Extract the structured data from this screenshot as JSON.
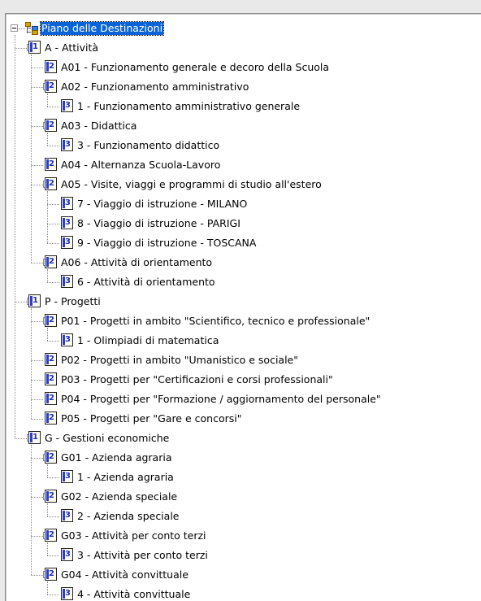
{
  "tree": {
    "root": {
      "label": "Piano delle Destinazioni",
      "selected": true
    },
    "nodes": [
      {
        "level": 1,
        "badge": "1",
        "label": "A - Attività",
        "expander": true
      },
      {
        "level": 2,
        "badge": "2",
        "label": "A01 - Funzionamento generale e decoro della Scuola",
        "expander": false
      },
      {
        "level": 2,
        "badge": "2",
        "label": "A02 - Funzionamento amministrativo",
        "expander": true
      },
      {
        "level": 3,
        "badge": "3",
        "label": "1 - Funzionamento amministrativo generale",
        "expander": false
      },
      {
        "level": 2,
        "badge": "2",
        "label": "A03 - Didattica",
        "expander": true
      },
      {
        "level": 3,
        "badge": "3",
        "label": "3 - Funzionamento didattico",
        "expander": false
      },
      {
        "level": 2,
        "badge": "2",
        "label": "A04 - Alternanza Scuola-Lavoro",
        "expander": false
      },
      {
        "level": 2,
        "badge": "2",
        "label": "A05 - Visite, viaggi e programmi di studio all'estero",
        "expander": true
      },
      {
        "level": 3,
        "badge": "3",
        "label": "7 - Viaggio di istruzione - MILANO",
        "expander": false
      },
      {
        "level": 3,
        "badge": "3",
        "label": "8 - Viaggio di istruzione - PARIGI",
        "expander": false
      },
      {
        "level": 3,
        "badge": "3",
        "label": "9 - Viaggio di istruzione - TOSCANA",
        "expander": false
      },
      {
        "level": 2,
        "badge": "2",
        "label": "A06 - Attività di orientamento",
        "expander": true
      },
      {
        "level": 3,
        "badge": "3",
        "label": "6 - Attività di orientamento",
        "expander": false
      },
      {
        "level": 1,
        "badge": "1",
        "label": "P - Progetti",
        "expander": true
      },
      {
        "level": 2,
        "badge": "2",
        "label": "P01 - Progetti in ambito \"Scientifico, tecnico e professionale\"",
        "expander": true
      },
      {
        "level": 3,
        "badge": "3",
        "label": "1 - Olimpiadi di matematica",
        "expander": false
      },
      {
        "level": 2,
        "badge": "2",
        "label": "P02 - Progetti in ambito \"Umanistico e sociale\"",
        "expander": false
      },
      {
        "level": 2,
        "badge": "2",
        "label": "P03 - Progetti per \"Certificazioni e corsi professionali\"",
        "expander": false
      },
      {
        "level": 2,
        "badge": "2",
        "label": "P04 - Progetti per \"Formazione / aggiornamento del personale\"",
        "expander": false
      },
      {
        "level": 2,
        "badge": "2",
        "label": "P05 - Progetti per \"Gare e concorsi\"",
        "expander": false
      },
      {
        "level": 1,
        "badge": "1",
        "label": "G - Gestioni economiche",
        "expander": true
      },
      {
        "level": 2,
        "badge": "2",
        "label": "G01 - Azienda agraria",
        "expander": true
      },
      {
        "level": 3,
        "badge": "3",
        "label": "1 - Azienda agraria",
        "expander": false
      },
      {
        "level": 2,
        "badge": "2",
        "label": "G02 - Azienda speciale",
        "expander": true
      },
      {
        "level": 3,
        "badge": "3",
        "label": "2 - Azienda speciale",
        "expander": false
      },
      {
        "level": 2,
        "badge": "2",
        "label": "G03 - Attività per conto terzi",
        "expander": true
      },
      {
        "level": 3,
        "badge": "3",
        "label": "3 - Attività per conto terzi",
        "expander": false
      },
      {
        "level": 2,
        "badge": "2",
        "label": "G04 - Attività convittuale",
        "expander": true
      },
      {
        "level": 3,
        "badge": "3",
        "label": "4 - Attività convittuale",
        "expander": false
      }
    ]
  }
}
